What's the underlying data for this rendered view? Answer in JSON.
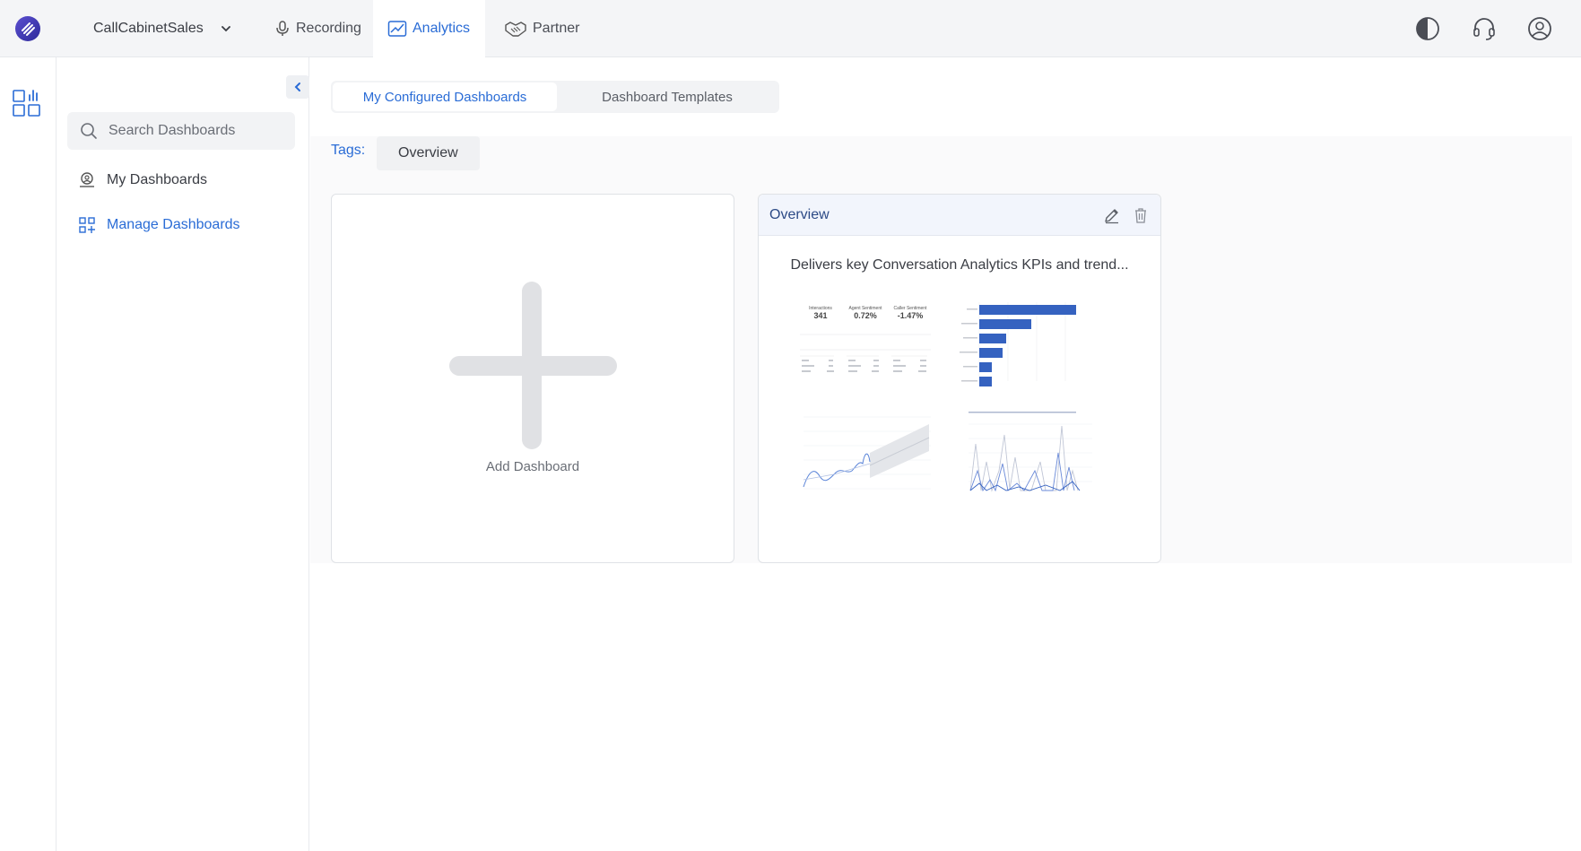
{
  "header": {
    "org_name": "CallCabinetSales",
    "nav": [
      {
        "label": "Recording",
        "icon": "microphone-icon"
      },
      {
        "label": "Analytics",
        "icon": "analytics-chart-icon",
        "active": true
      },
      {
        "label": "Partner",
        "icon": "handshake-icon"
      }
    ],
    "right_icons": [
      "contrast-toggle-icon",
      "headset-support-icon",
      "user-profile-icon"
    ]
  },
  "sidebar": {
    "search_placeholder": "Search Dashboards",
    "links": [
      {
        "label": "My Dashboards",
        "icon": "user-dashboard-icon"
      },
      {
        "label": "Manage Dashboards",
        "icon": "manage-grid-icon",
        "active": true
      }
    ]
  },
  "main": {
    "tabs": [
      {
        "label": "My Configured Dashboards",
        "active": true
      },
      {
        "label": "Dashboard Templates"
      }
    ],
    "tags_label": "Tags:",
    "tags": [
      "Overview"
    ],
    "add_card": {
      "label": "Add Dashboard"
    },
    "dashboards": [
      {
        "title": "Overview",
        "description": "Delivers key Conversation Analytics KPIs and trend...",
        "preview": {
          "kpis": [
            {
              "label": "Interactions",
              "value": "341"
            },
            {
              "label": "Agent Sentiment",
              "value": "0.72%"
            },
            {
              "label": "Caller Sentiment",
              "value": "-1.47%"
            }
          ]
        }
      }
    ]
  },
  "colors": {
    "accent": "#2a6cd6",
    "brand_logo": "#4a3fb5",
    "bar_blue": "#3562c0"
  }
}
